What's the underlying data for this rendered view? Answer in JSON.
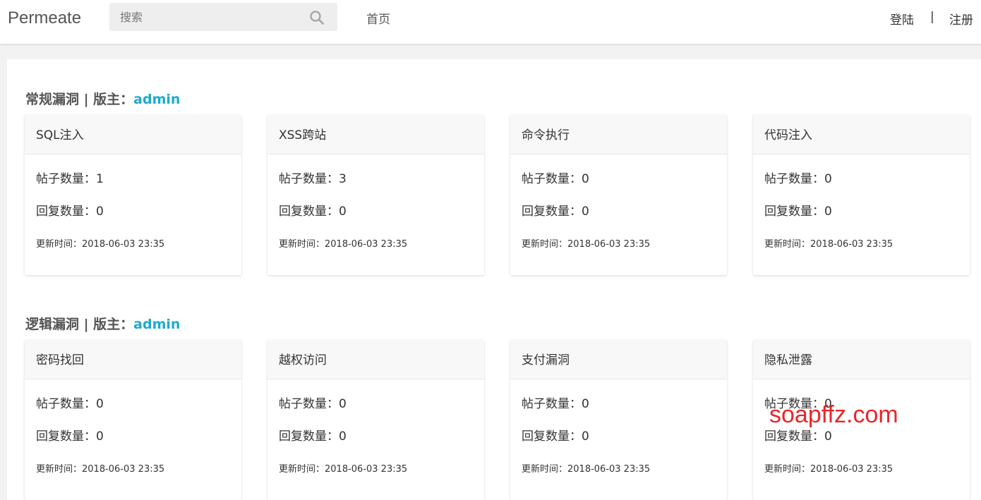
{
  "header": {
    "logo": "Permeate",
    "search_placeholder": "搜索",
    "nav_home": "首页",
    "login": "登陆",
    "separator": "|",
    "register": "注册"
  },
  "sections": [
    {
      "title": "常规漏洞 | 版主：",
      "moderator": "admin",
      "boards": [
        {
          "name": "SQL注入",
          "posts": "帖子数量：1",
          "replies": "回复数量：0",
          "updated": "更新时间：2018-06-03 23:35"
        },
        {
          "name": "XSS跨站",
          "posts": "帖子数量：3",
          "replies": "回复数量：0",
          "updated": "更新时间：2018-06-03 23:35"
        },
        {
          "name": "命令执行",
          "posts": "帖子数量：0",
          "replies": "回复数量：0",
          "updated": "更新时间：2018-06-03 23:35"
        },
        {
          "name": "代码注入",
          "posts": "帖子数量：0",
          "replies": "回复数量：0",
          "updated": "更新时间：2018-06-03 23:35"
        }
      ]
    },
    {
      "title": "逻辑漏洞 | 版主：",
      "moderator": "admin",
      "boards": [
        {
          "name": "密码找回",
          "posts": "帖子数量：0",
          "replies": "回复数量：0",
          "updated": "更新时间：2018-06-03 23:35"
        },
        {
          "name": "越权访问",
          "posts": "帖子数量：0",
          "replies": "回复数量：0",
          "updated": "更新时间：2018-06-03 23:35"
        },
        {
          "name": "支付漏洞",
          "posts": "帖子数量：0",
          "replies": "回复数量：0",
          "updated": "更新时间：2018-06-03 23:35"
        },
        {
          "name": "隐私泄露",
          "posts": "帖子数量：0",
          "replies": "回复数量：0",
          "updated": "更新时间：2018-06-03 23:35"
        }
      ]
    }
  ],
  "watermark": "soapffz.com",
  "colors": {
    "accent": "#1eaacb",
    "watermark": "#e8262a"
  }
}
